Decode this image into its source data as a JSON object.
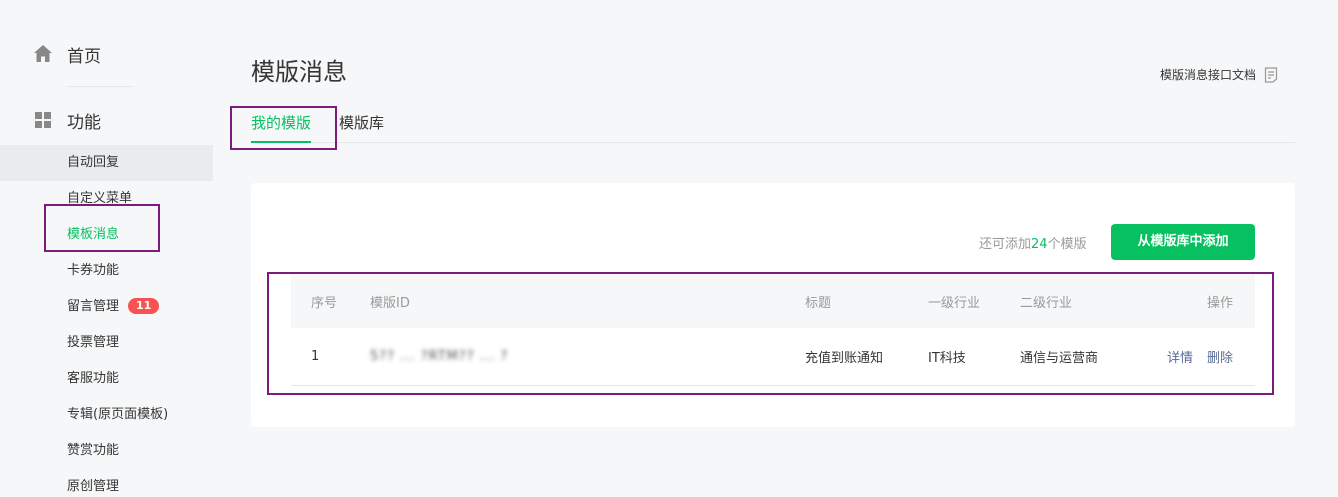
{
  "sidebar": {
    "home_label": "首页",
    "features_label": "功能",
    "items": [
      {
        "label": "自动回复"
      },
      {
        "label": "自定义菜单"
      },
      {
        "label": "模板消息"
      },
      {
        "label": "卡券功能"
      },
      {
        "label": "留言管理",
        "badge": "11"
      },
      {
        "label": "投票管理"
      },
      {
        "label": "客服功能"
      },
      {
        "label": "专辑(原页面模板)"
      },
      {
        "label": "赞赏功能"
      },
      {
        "label": "原创管理"
      }
    ]
  },
  "header": {
    "title": "模版消息",
    "doc_link": "模版消息接口文档",
    "doc_icon": "document-icon"
  },
  "tabs": [
    {
      "label": "我的模版"
    },
    {
      "label": "模版库"
    }
  ],
  "panel": {
    "quota_prefix": "还可添加",
    "quota_count": "24",
    "quota_suffix": "个模版",
    "add_button": "从模版库中添加"
  },
  "table": {
    "columns": [
      "序号",
      "模版ID",
      "标题",
      "一级行业",
      "二级行业",
      "操作"
    ],
    "rows": [
      {
        "index": "1",
        "template_id": "5?? ... ?RTM?? ... ?",
        "title": "充值到账通知",
        "industry_primary": "IT科技",
        "industry_secondary": "通信与运营商",
        "action_detail": "详情",
        "action_delete": "删除"
      }
    ]
  },
  "colors": {
    "accent": "#07c160",
    "link": "#576b95",
    "badge": "#fa5151",
    "annotation": "#7b1b7e"
  }
}
